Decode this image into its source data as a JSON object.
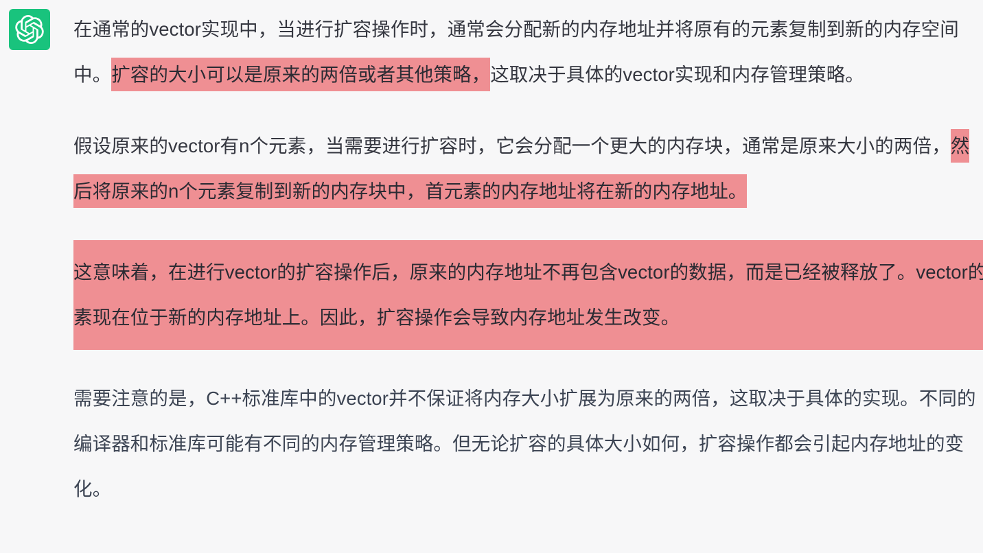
{
  "app": {
    "name": "ChatGPT conversation message",
    "background_color": "#f7f7f8",
    "avatar_color": "#19c37d",
    "text_color": "#353740",
    "highlight_color": "#ef8f93"
  },
  "avatar": {
    "icon": "openai-logo-icon",
    "alt": "ChatGPT assistant avatar"
  },
  "message": {
    "paragraphs": [
      {
        "id": "p1",
        "segments": [
          {
            "highlighted": false,
            "text": "在通常的vector实现中，当进行扩容操作时，通常会分配新的内存地址并将原有的元素复制到新的内存空间中。"
          },
          {
            "highlighted": true,
            "text": "扩容的大小可以是原来的两倍或者其他策略，"
          },
          {
            "highlighted": false,
            "text": "这取决于具体的vector实现和内存管理策略。"
          }
        ]
      },
      {
        "id": "p2",
        "segments": [
          {
            "highlighted": false,
            "text": "假设原来的vector有n个元素，当需要进行扩容时，它会分配一个更大的内存块，通常是原来大小的两倍，"
          },
          {
            "highlighted": true,
            "text": "然后将原来的n个元素复制到新的内存块中，首元素的内存地址将在新的内存地址。"
          }
        ]
      },
      {
        "id": "p3",
        "block_highlight": true,
        "segments": [
          {
            "highlighted": true,
            "text": "这意味着，在进行vector的扩容操作后，原来的内存地址不再包含vector的数据，而是已经被释放了。vector的元素现在位于新的内存地址上。因此，扩容操作会导致内存地址发生改变。"
          }
        ]
      },
      {
        "id": "p4",
        "segments": [
          {
            "highlighted": false,
            "text": "需要注意的是，C++标准库中的vector并不保证将内存大小扩展为原来的两倍，这取决于具体的实现。不同的编译器和标准库可能有不同的内存管理策略。但无论扩容的具体大小如何，扩容操作都会引起内存地址的变化。"
          }
        ]
      }
    ]
  }
}
